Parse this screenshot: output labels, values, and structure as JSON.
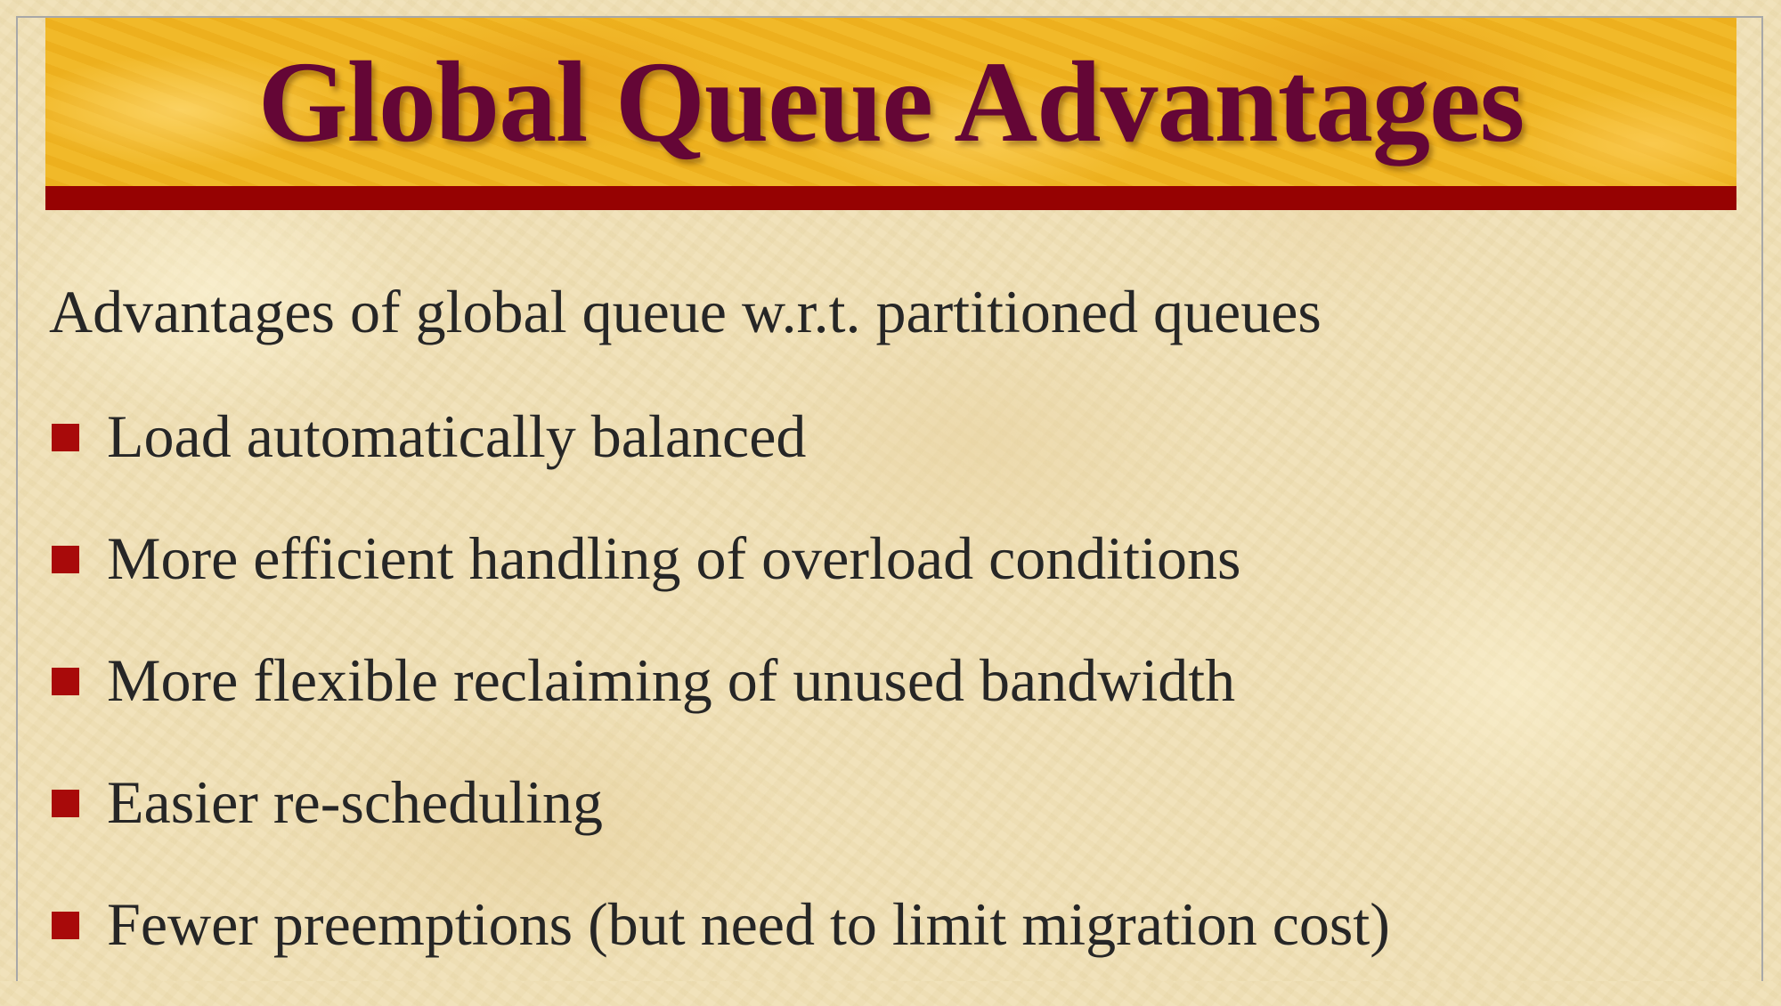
{
  "slide": {
    "title": "Global Queue Advantages",
    "intro": "Advantages of global queue w.r.t. partitioned queues",
    "bullets": [
      "Load automatically balanced",
      "More efficient handling of overload conditions",
      "More flexible reclaiming of unused bandwidth",
      "Easier re-scheduling",
      "Fewer preemptions (but need to limit migration cost)"
    ]
  },
  "colors": {
    "title_text": "#640636",
    "title_banner": "#f0b520",
    "title_rule": "#960202",
    "bullet_marker": "#a80a0a",
    "body_text": "#262626",
    "background": "#efe0b6"
  },
  "icons": {
    "bullet": "square-bullet-icon"
  }
}
